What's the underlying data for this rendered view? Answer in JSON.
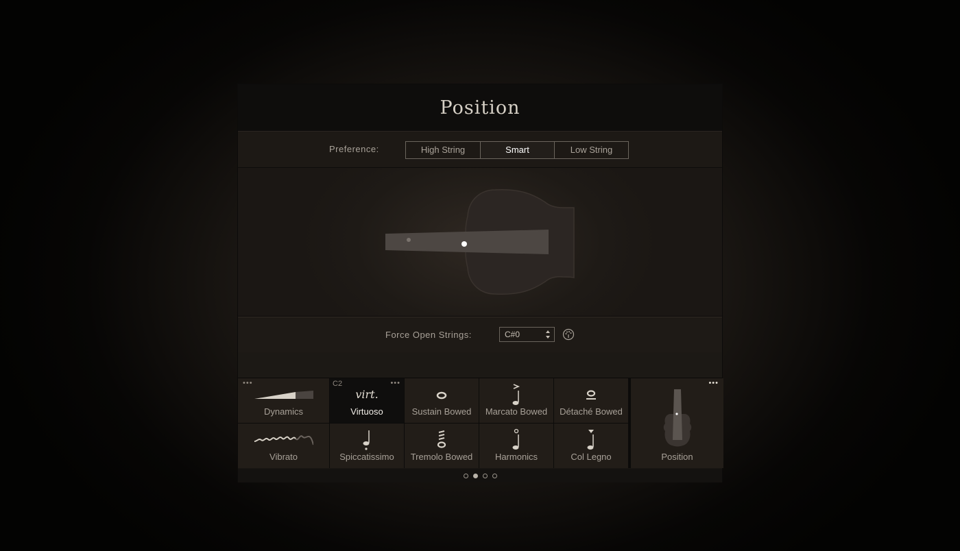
{
  "header": {
    "title": "Position"
  },
  "preference": {
    "label": "Preference:",
    "options": [
      "High String",
      "Smart",
      "Low String"
    ],
    "selected": "Smart"
  },
  "force_open": {
    "label": "Force Open Strings:",
    "value": "C#0",
    "icon": "midi-learn-icon"
  },
  "articulations": {
    "left_column": [
      {
        "label": "Dynamics",
        "icon": "dynamics-wedge-icon"
      },
      {
        "label": "Vibrato",
        "icon": "vibrato-wave-icon"
      }
    ],
    "row1": [
      {
        "label": "Virtuoso",
        "symbol": "virt.",
        "key": "C2",
        "selected": true
      },
      {
        "label": "Sustain Bowed",
        "icon": "whole-note-icon"
      },
      {
        "label": "Marcato Bowed",
        "icon": "marcato-note-icon"
      },
      {
        "label": "Détaché Bowed",
        "icon": "tenuto-note-icon"
      }
    ],
    "row2": [
      {
        "label": "Spiccatissimo",
        "icon": "staccato-note-icon"
      },
      {
        "label": "Tremolo Bowed",
        "icon": "tremolo-note-icon"
      },
      {
        "label": "Harmonics",
        "icon": "harmonic-note-icon"
      },
      {
        "label": "Col Legno",
        "icon": "col-legno-note-icon"
      }
    ],
    "right_panel": {
      "label": "Position",
      "icon": "violin-position-icon"
    }
  },
  "pager": {
    "pages": 4,
    "current": 2
  },
  "colors": {
    "accent": "#ffffff",
    "text": "#a8a198",
    "background": "#191613"
  }
}
